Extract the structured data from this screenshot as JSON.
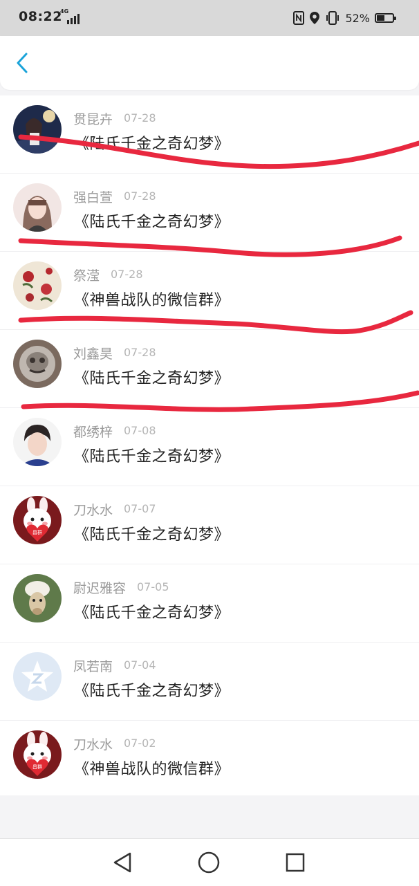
{
  "status_bar": {
    "time": "08:22",
    "network": "4G",
    "battery_percent": "52%",
    "battery_level": 0.52
  },
  "header": {
    "back_icon": "chevron-left-icon",
    "accent_color": "#1aa3d9"
  },
  "messages": [
    {
      "name": "贯昆卉",
      "date": "07-28",
      "text": "《陆氏千金之奇幻梦》",
      "avatar": "anime-girl-dark"
    },
    {
      "name": "强白萱",
      "date": "07-28",
      "text": "《陆氏千金之奇幻梦》",
      "avatar": "girl-photo"
    },
    {
      "name": "祭滢",
      "date": "07-28",
      "text": "《神兽战队的微信群》",
      "avatar": "roses-pattern"
    },
    {
      "name": "刘鑫昊",
      "date": "07-28",
      "text": "《陆氏千金之奇幻梦》",
      "avatar": "metal-mask"
    },
    {
      "name": "都绣梓",
      "date": "07-08",
      "text": "《陆氏千金之奇幻梦》",
      "avatar": "boy-photo"
    },
    {
      "name": "刀水水",
      "date": "07-07",
      "text": "《陆氏千金之奇幻梦》",
      "avatar": "cartoon-bunny-heart"
    },
    {
      "name": "尉迟雅容",
      "date": "07-05",
      "text": "《陆氏千金之奇幻梦》",
      "avatar": "alpaca"
    },
    {
      "name": "凤若南",
      "date": "07-04",
      "text": "《陆氏千金之奇幻梦》",
      "avatar": "default-qzone-star"
    },
    {
      "name": "刀水水",
      "date": "07-02",
      "text": "《神兽战队的微信群》",
      "avatar": "cartoon-bunny-heart"
    }
  ],
  "bunny_heart_text": "昌群",
  "annotation_color": "#e8283f",
  "nav": {
    "back": "triangle-back-icon",
    "home": "circle-home-icon",
    "recents": "square-recents-icon"
  }
}
